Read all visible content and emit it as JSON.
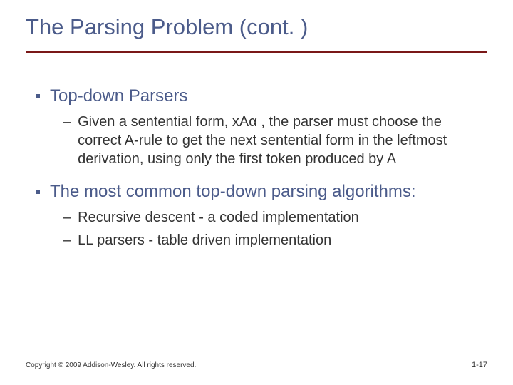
{
  "title": "The Parsing Problem (cont. )",
  "bullets": [
    {
      "text": "Top-down Parsers",
      "sub": [
        "Given a sentential form, xAα , the parser must choose the correct A-rule to get the next sentential form in the leftmost derivation, using only the first token produced by A"
      ]
    },
    {
      "text": "The most common top-down parsing algorithms:",
      "sub": [
        "Recursive descent - a coded implementation",
        "LL parsers - table driven implementation"
      ]
    }
  ],
  "footer": {
    "copyright": "Copyright © 2009 Addison-Wesley. All rights reserved.",
    "page": "1-17"
  }
}
